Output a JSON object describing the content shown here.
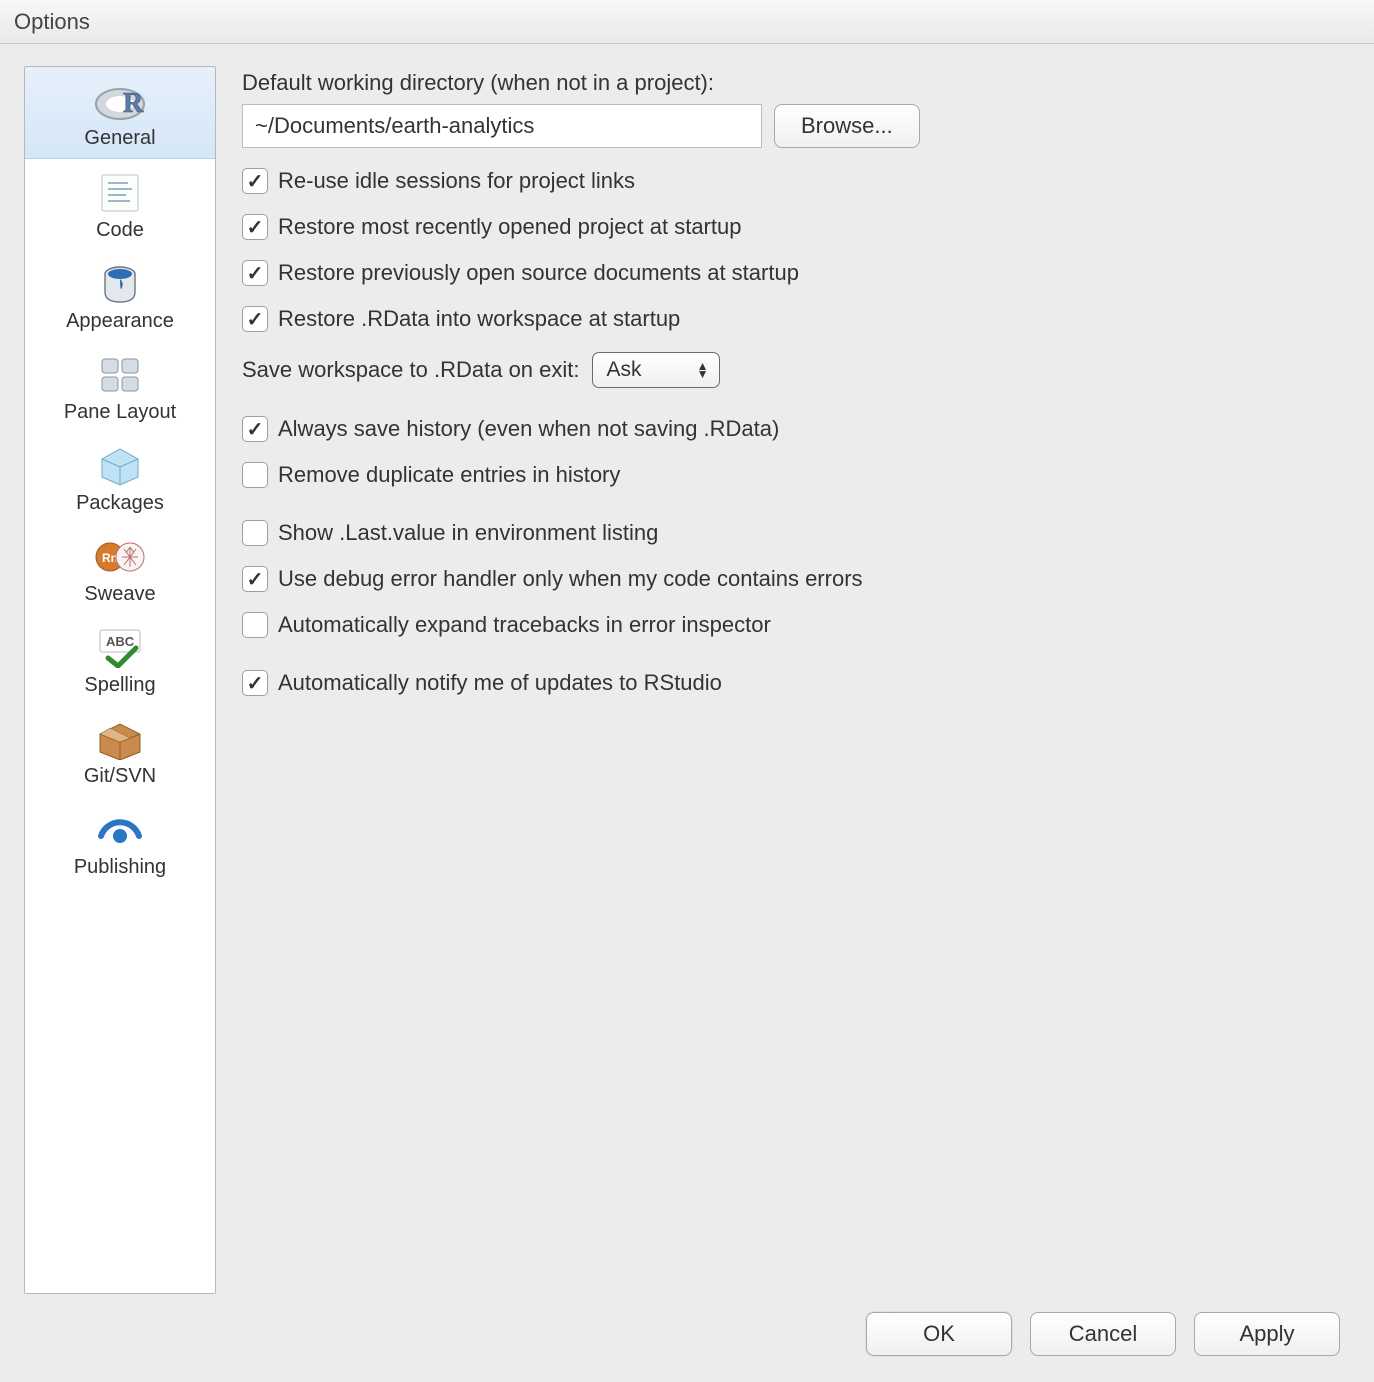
{
  "window": {
    "title": "Options"
  },
  "sidebar": {
    "items": [
      {
        "label": "General"
      },
      {
        "label": "Code"
      },
      {
        "label": "Appearance"
      },
      {
        "label": "Pane Layout"
      },
      {
        "label": "Packages"
      },
      {
        "label": "Sweave"
      },
      {
        "label": "Spelling"
      },
      {
        "label": "Git/SVN"
      },
      {
        "label": "Publishing"
      }
    ],
    "selected_index": 0
  },
  "main": {
    "wd_label": "Default working directory (when not in a project):",
    "wd_value": "~/Documents/earth-analytics",
    "browse": "Browse...",
    "checks": {
      "reuse_idle": {
        "label": "Re-use idle sessions for project links",
        "checked": true
      },
      "restore_project": {
        "label": "Restore most recently opened project at startup",
        "checked": true
      },
      "restore_docs": {
        "label": "Restore previously open source documents at startup",
        "checked": true
      },
      "restore_rdata": {
        "label": "Restore .RData into workspace at startup",
        "checked": true
      },
      "save_history": {
        "label": "Always save history (even when not saving .RData)",
        "checked": true
      },
      "remove_dup": {
        "label": "Remove duplicate entries in history",
        "checked": false
      },
      "show_last": {
        "label": "Show .Last.value in environment listing",
        "checked": false
      },
      "debug_handler": {
        "label": "Use debug error handler only when my code contains errors",
        "checked": true
      },
      "auto_traceback": {
        "label": "Automatically expand tracebacks in error inspector",
        "checked": false
      },
      "notify_updates": {
        "label": "Automatically notify me of updates to RStudio",
        "checked": true
      }
    },
    "save_ws_label": "Save workspace to .RData on exit:",
    "save_ws_value": "Ask"
  },
  "footer": {
    "ok": "OK",
    "cancel": "Cancel",
    "apply": "Apply"
  }
}
